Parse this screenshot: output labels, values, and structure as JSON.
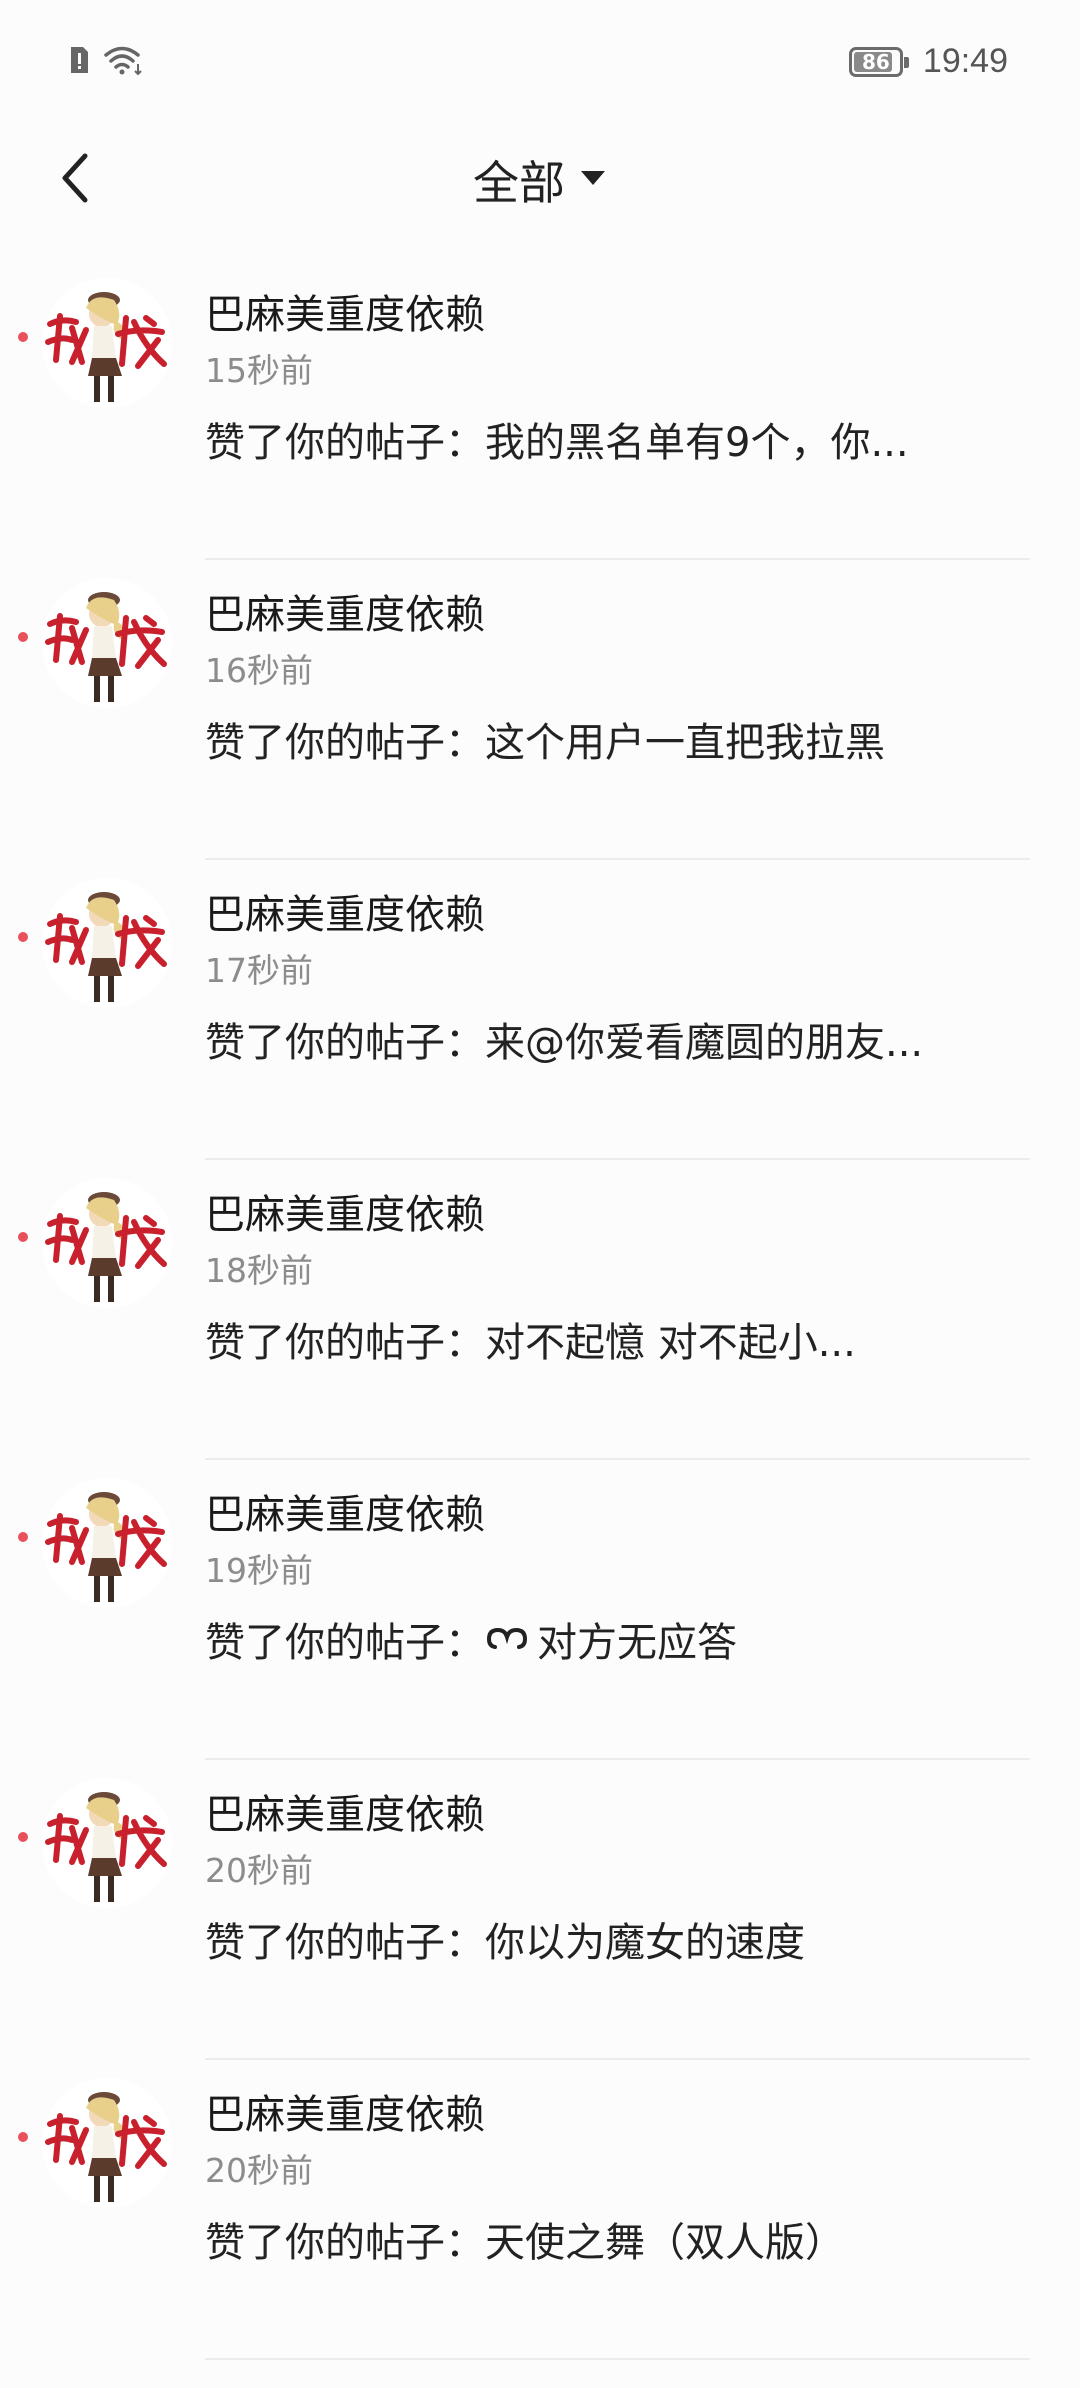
{
  "status_bar": {
    "battery_level": 86,
    "battery_text": "86",
    "time": "19:49"
  },
  "header": {
    "title": "全部"
  },
  "notifications": [
    {
      "name": "巴麻美重度依赖",
      "time": "15秒前",
      "prefix": "赞了你的帖子：",
      "text": "我的黑名单有9个，你...",
      "emoji": ""
    },
    {
      "name": "巴麻美重度依赖",
      "time": "16秒前",
      "prefix": "赞了你的帖子：",
      "text": "这个用户一直把我拉黑",
      "emoji": ""
    },
    {
      "name": "巴麻美重度依赖",
      "time": "17秒前",
      "prefix": "赞了你的帖子：",
      "text": "来@你爱看魔圆的朋友...",
      "emoji": ""
    },
    {
      "name": "巴麻美重度依赖",
      "time": "18秒前",
      "prefix": "赞了你的帖子：",
      "text": "对不起憶  对不起小...",
      "emoji": ""
    },
    {
      "name": "巴麻美重度依赖",
      "time": "19秒前",
      "prefix": "赞了你的帖子：",
      "text": "对方无应答",
      "emoji": "link-icon"
    },
    {
      "name": "巴麻美重度依赖",
      "time": "20秒前",
      "prefix": "赞了你的帖子：",
      "text": "你以为魔女的速度",
      "emoji": ""
    },
    {
      "name": "巴麻美重度依赖",
      "time": "20秒前",
      "prefix": "赞了你的帖子：",
      "text": "天使之舞（双人版）",
      "emoji": ""
    }
  ],
  "colors": {
    "unread_dot": "#e8515a",
    "avatar_red": "#c8202c"
  }
}
